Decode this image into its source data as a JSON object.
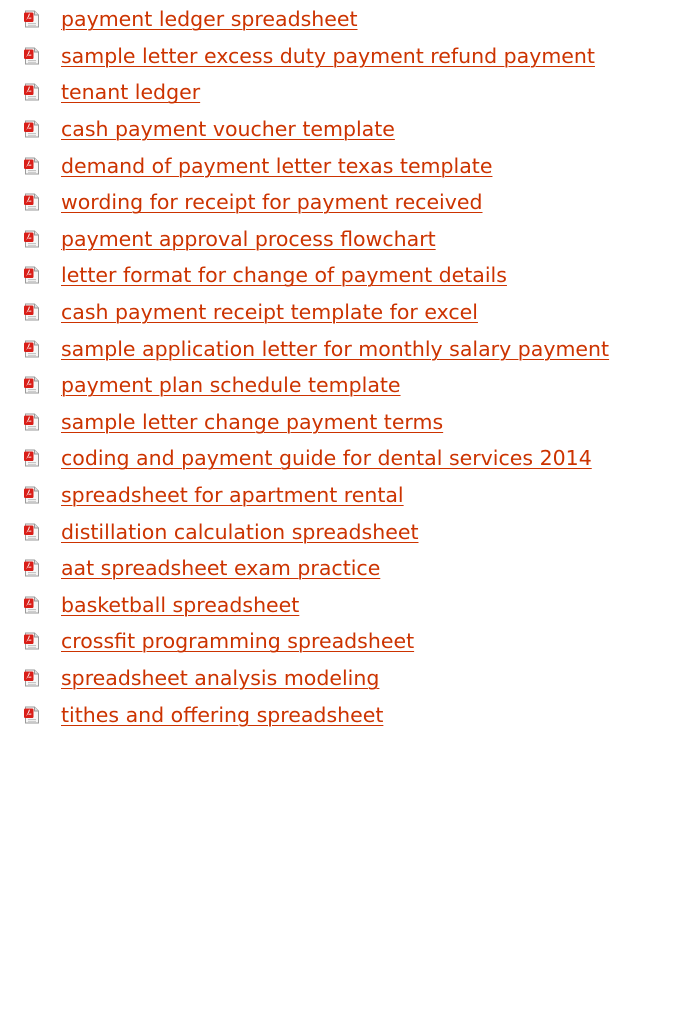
{
  "icon": {
    "name": "pdf-file-icon",
    "accent": "#cc3300",
    "icon_red": "#d91e18",
    "icon_gray": "#b0b0b0"
  },
  "links": [
    {
      "label": "payment ledger spreadsheet"
    },
    {
      "label": "sample letter excess duty payment refund payment"
    },
    {
      "label": "tenant ledger"
    },
    {
      "label": "cash payment voucher template"
    },
    {
      "label": "demand of payment letter texas template"
    },
    {
      "label": "wording for receipt for payment received"
    },
    {
      "label": "payment approval process flowchart"
    },
    {
      "label": "letter format for change of payment details"
    },
    {
      "label": "cash payment receipt template for excel"
    },
    {
      "label": "sample application letter for monthly salary payment"
    },
    {
      "label": "payment plan schedule template"
    },
    {
      "label": "sample letter change payment terms"
    },
    {
      "label": "coding and payment guide for dental services 2014"
    },
    {
      "label": "spreadsheet for apartment rental"
    },
    {
      "label": "distillation calculation spreadsheet"
    },
    {
      "label": "aat spreadsheet exam practice"
    },
    {
      "label": "basketball spreadsheet"
    },
    {
      "label": "crossfit programming spreadsheet"
    },
    {
      "label": "spreadsheet analysis modeling"
    },
    {
      "label": "tithes and offering spreadsheet"
    }
  ]
}
